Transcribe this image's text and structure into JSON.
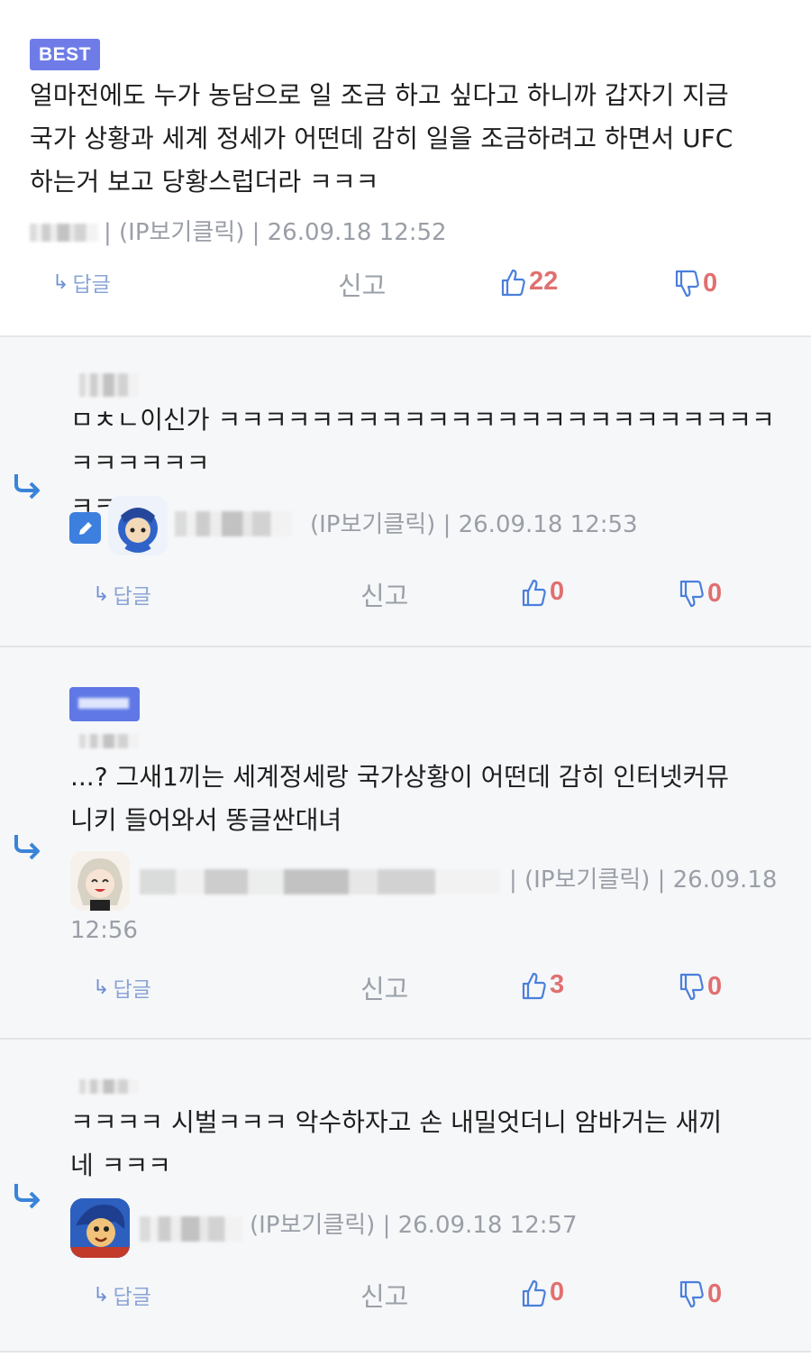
{
  "best_comment": {
    "badge": "BEST",
    "text": "얼마전에도 누가 농담으로 일 조금 하고 싶다고 하니까 갑자기 지금\n국가 상황과 세계 정세가 어떤데 감히 일을 조금하려고 하면서 UFC\n하는거 보고 당황스럽더라 ㅋㅋㅋ",
    "meta": "| (IP보기클릭) | 26.09.18 12:52",
    "reply_label": "답글",
    "report_label": "신고",
    "likes": "22",
    "dislikes": "0"
  },
  "replies": [
    {
      "text": "ㅁㅊㄴ이신가 ㅋㅋㅋㅋㅋㅋㅋㅋㅋㅋㅋㅋㅋㅋㅋㅋㅋㅋㅋㅋㅋㅋㅋㅋㅋㅋㅋㅋㅋㅋ\nㅋㅋㅋ",
      "meta": "(IP보기클릭) | 26.09.18 12:53",
      "reply_label": "답글",
      "report_label": "신고",
      "likes": "0",
      "dislikes": "0"
    },
    {
      "text": "...? 그새1끼는 세계정세랑 국가상황이 어떤데 감히 인터넷커뮤\n니키 들어와서 똥글싼대녀",
      "meta": "| (IP보기클릭) | 26.09.18",
      "meta_line2": "12:56",
      "reply_label": "답글",
      "report_label": "신고",
      "likes": "3",
      "dislikes": "0"
    },
    {
      "text": "ㅋㅋㅋㅋ 시벌ㅋㅋㅋ 악수하자고 손 내밀엇더니 암바거는 새끼\n네 ㅋㅋㅋ",
      "meta": "(IP보기클릭) | 26.09.18 12:57",
      "reply_label": "답글",
      "report_label": "신고",
      "likes": "0",
      "dislikes": "0"
    }
  ],
  "icons": {
    "reply_arrow": "reply-arrow-icon",
    "thumbs_up": "thumbs-up-icon",
    "thumbs_down": "thumbs-down-icon",
    "pen": "pen-icon"
  },
  "colors": {
    "best_badge": "#6f7ce8",
    "like": "#e07070",
    "icon_blue": "#4a7fdc",
    "reply_bg": "#f6f7f9"
  }
}
